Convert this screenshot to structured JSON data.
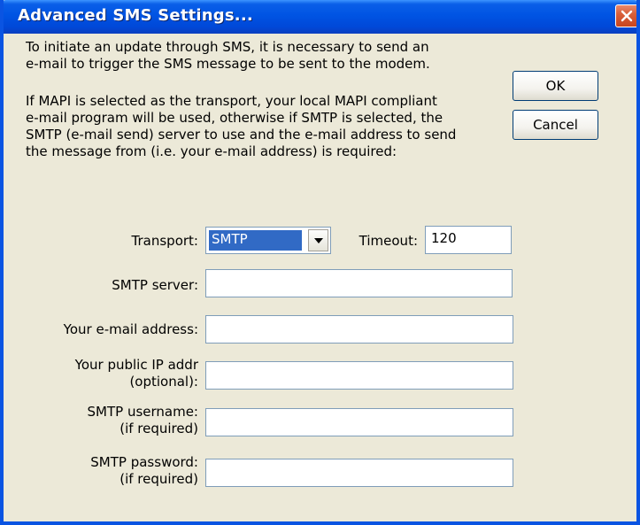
{
  "window": {
    "title": "Advanced SMS Settings..."
  },
  "description": {
    "intro": "To initiate an update through SMS, it is necessary to send an\ne-mail to trigger the SMS message to be sent to the modem.",
    "mapi": "If MAPI is selected as the transport, your local MAPI compliant\ne-mail program will be used, otherwise if SMTP is selected, the\nSMTP (e-mail send) server to use and the e-mail address to send\nthe message from (i.e. your e-mail address) is required:"
  },
  "buttons": {
    "ok": "OK",
    "cancel": "Cancel"
  },
  "form": {
    "transport_label": "Transport:",
    "transport_value": "SMTP",
    "timeout_label": "Timeout:",
    "timeout_value": "120",
    "smtp_server_label": "SMTP server:",
    "smtp_server_value": "",
    "email_label": "Your e-mail address:",
    "email_value": "",
    "public_ip_label": "Your public IP addr\n(optional):",
    "public_ip_value": "",
    "username_label": "SMTP username:\n(if required)",
    "username_value": "",
    "password_label": "SMTP password:\n(if required)",
    "password_value": ""
  },
  "icons": {
    "close": "close-icon",
    "dropdown": "chevron-down-icon"
  },
  "colors": {
    "titlebar": "#0054e3",
    "dialog_bg": "#ece9d8",
    "selection": "#316ac5",
    "close_button": "#d95f3a"
  }
}
